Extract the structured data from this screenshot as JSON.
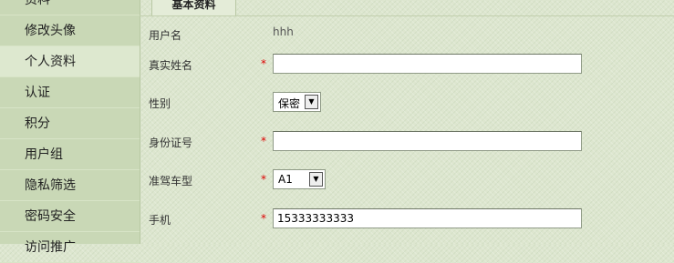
{
  "sidebar": {
    "items": [
      {
        "label": "资料"
      },
      {
        "label": "修改头像"
      },
      {
        "label": "个人资料"
      },
      {
        "label": "认证"
      },
      {
        "label": "积分"
      },
      {
        "label": "用户组"
      },
      {
        "label": "隐私筛选"
      },
      {
        "label": "密码安全"
      },
      {
        "label": "访问推广"
      }
    ]
  },
  "tabs": [
    {
      "label": "基本资料"
    }
  ],
  "form": {
    "username": {
      "label": "用户名",
      "value": "hhh"
    },
    "realname": {
      "label": "真实姓名",
      "required": "*",
      "value": ""
    },
    "gender": {
      "label": "性别",
      "value": "保密",
      "arrow": "▼"
    },
    "idcard": {
      "label": "身份证号",
      "required": "*",
      "value": ""
    },
    "license": {
      "label": "准驾车型",
      "required": "*",
      "value": "A1",
      "arrow": "▼"
    },
    "phone": {
      "label": "手机",
      "required": "*",
      "value": "15333333333"
    }
  }
}
